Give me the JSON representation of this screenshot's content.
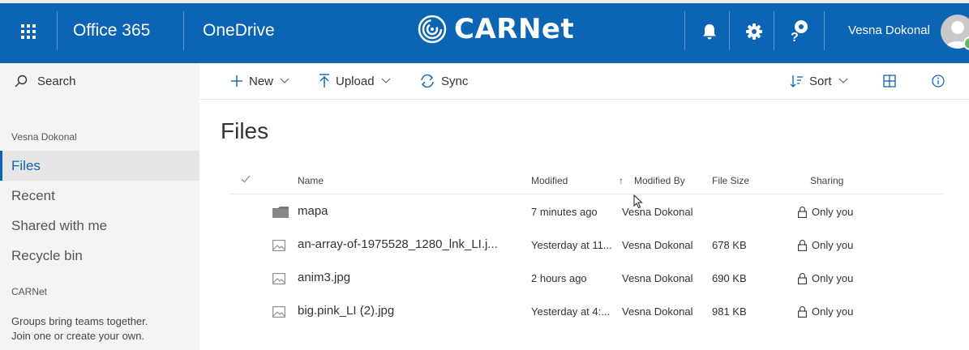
{
  "suite": {
    "app_launcher_icon": "waffle-icon",
    "office_label": "Office 365",
    "app_label": "OneDrive",
    "brand_name": "CARNet",
    "brand_color": "#0c64b4",
    "notifications_icon": "bell-icon",
    "settings_icon": "gear-icon",
    "help_icon": "help-icon",
    "user_name": "Vesna Dokonal"
  },
  "search": {
    "label": "Search"
  },
  "commands": {
    "new_label": "New",
    "upload_label": "Upload",
    "sync_label": "Sync",
    "sort_label": "Sort"
  },
  "nav": {
    "owner": "Vesna Dokonal",
    "items": [
      {
        "label": "Files",
        "selected": true
      },
      {
        "label": "Recent"
      },
      {
        "label": "Shared with me"
      },
      {
        "label": "Recycle bin"
      }
    ],
    "group": "CARNet",
    "promo_line1": "Groups bring teams together.",
    "promo_line2": "Join one or create your own."
  },
  "main": {
    "title": "Files",
    "columns": {
      "name": "Name",
      "modified": "Modified",
      "modified_by": "Modified By",
      "file_size": "File Size",
      "sharing": "Sharing"
    },
    "sort_indicator": "↑",
    "rows": [
      {
        "type": "folder",
        "name": "mapa",
        "modified": "7 minutes ago",
        "modified_by": "Vesna Dokonal",
        "size": "",
        "sharing": "Only you"
      },
      {
        "type": "image",
        "name": "an-array-of-1975528_1280_lnk_LI.j...",
        "modified": "Yesterday at 11...",
        "modified_by": "Vesna Dokonal",
        "size": "678 KB",
        "sharing": "Only you"
      },
      {
        "type": "image",
        "name": "anim3.jpg",
        "modified": "2 hours ago",
        "modified_by": "Vesna Dokonal",
        "size": "690 KB",
        "sharing": "Only you"
      },
      {
        "type": "image",
        "name": "big.pink_LI (2).jpg",
        "modified": "Yesterday at 4:...",
        "modified_by": "Vesna Dokonal",
        "size": "981 KB",
        "sharing": "Only you"
      }
    ]
  }
}
